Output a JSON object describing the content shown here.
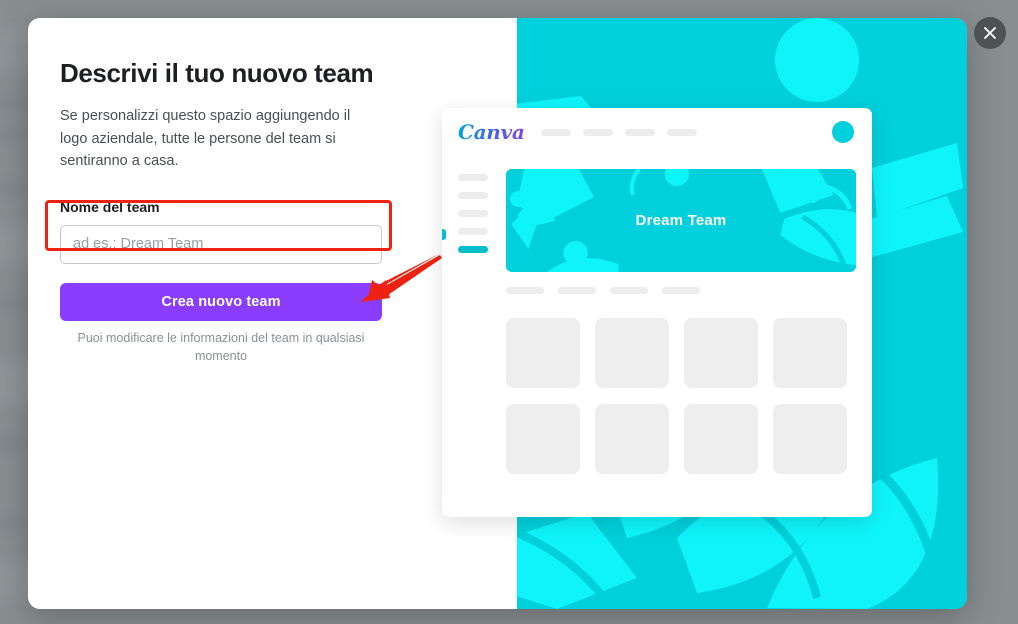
{
  "overlay": {
    "close_button_label": "Chiudi",
    "close_icon": "close-icon"
  },
  "modal": {
    "title": "Descrivi il tuo nuovo team",
    "subtitle": "Se personalizzi questo spazio aggiungendo il logo aziendale, tutte le persone del team si sentiranno a casa.",
    "field_label": "Nome del team",
    "input_value": "",
    "input_placeholder": "ad es.: Dream Team",
    "submit_label": "Crea nuovo team",
    "helper_text": "Puoi modificare le informazioni del team in qualsiasi momento"
  },
  "preview": {
    "logo_text": "Canva",
    "banner_text": "Dream Team",
    "nav_pills": 4,
    "sidebar_pills": 5,
    "tab_pills": 4,
    "thumbnails": 8,
    "avatar": "avatar-dot"
  },
  "colors": {
    "accent_purple": "#8b3dff",
    "cyan": "#00d0db",
    "bright_cyan": "#00f0f8",
    "annotation_red": "#ee2211",
    "overlay_grey": "#919598",
    "placeholder_grey": "#eeeeef"
  }
}
